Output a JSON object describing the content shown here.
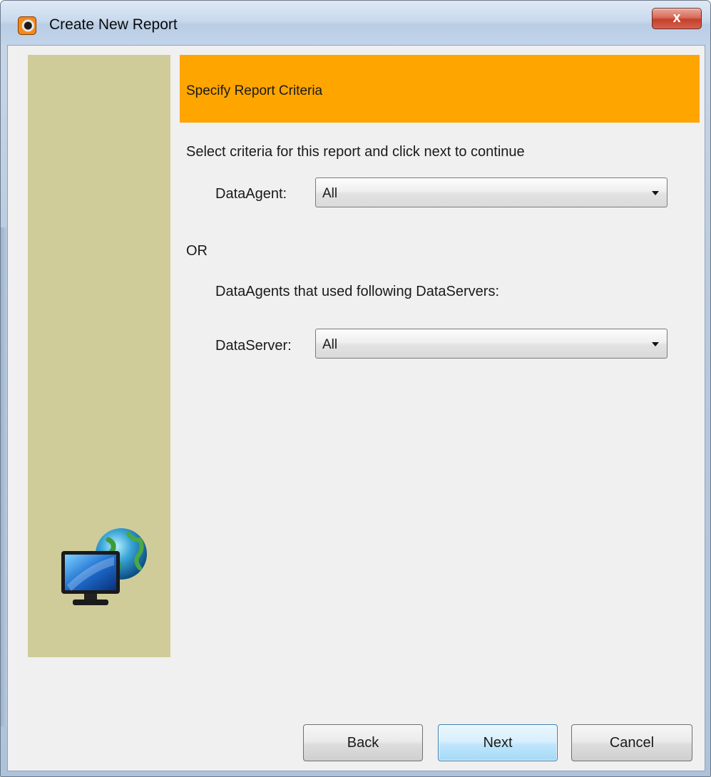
{
  "window": {
    "title": "Create New Report",
    "close_label": "x"
  },
  "wizard": {
    "header_title": "Specify Report Criteria",
    "instructions": "Select criteria for this report and click next to continue",
    "dataagent_label": "DataAgent:",
    "dataagent_value": "All",
    "or_label": "OR",
    "dataservers_caption": "DataAgents that used following DataServers:",
    "dataserver_label": "DataServer:",
    "dataserver_value": "All"
  },
  "buttons": {
    "back": "Back",
    "next": "Next",
    "cancel": "Cancel"
  },
  "colors": {
    "header_band": "#ffa500",
    "sidebar": "#cfcc9a",
    "client_bg": "#f0f0f0"
  },
  "icons": {
    "app": "report-app-icon",
    "sidebar_graphic": "monitor-globe-icon",
    "dropdown": "chevron-down-icon"
  }
}
